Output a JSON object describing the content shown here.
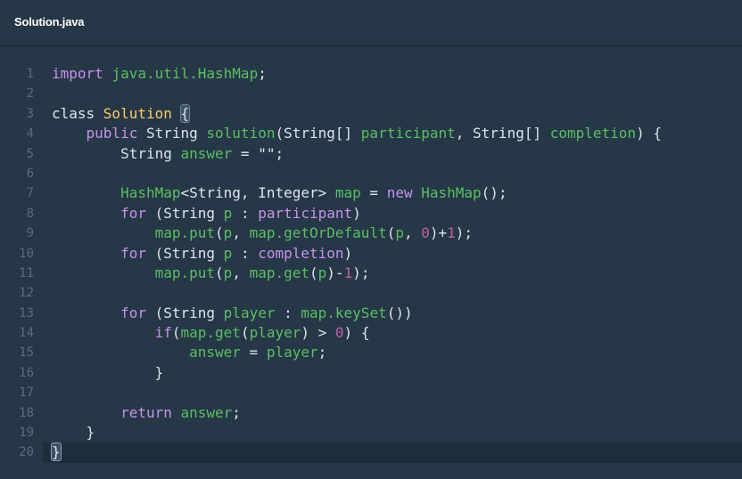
{
  "tab": {
    "filename": "Solution.java"
  },
  "editor": {
    "active_line": 20,
    "lines": [
      {
        "n": "1",
        "tokens": [
          [
            "kw",
            "import "
          ],
          [
            "id",
            "java.util.HashMap"
          ],
          [
            "pl",
            ";"
          ]
        ]
      },
      {
        "n": "2",
        "tokens": []
      },
      {
        "n": "3",
        "tokens": [
          [
            "pl",
            "class "
          ],
          [
            "cls",
            "Solution "
          ],
          [
            "brk",
            "{"
          ]
        ]
      },
      {
        "n": "4",
        "tokens": [
          [
            "pl",
            "    "
          ],
          [
            "kw",
            "public "
          ],
          [
            "pl",
            "String "
          ],
          [
            "id",
            "solution"
          ],
          [
            "pl",
            "(String[] "
          ],
          [
            "id",
            "participant"
          ],
          [
            "pl",
            ", String[] "
          ],
          [
            "id",
            "completion"
          ],
          [
            "pl",
            ") {"
          ]
        ]
      },
      {
        "n": "5",
        "tokens": [
          [
            "pl",
            "        String "
          ],
          [
            "id",
            "answer"
          ],
          [
            "pl",
            " = "
          ],
          [
            "str",
            "\"\""
          ],
          [
            "pl",
            ";"
          ]
        ]
      },
      {
        "n": "6",
        "tokens": []
      },
      {
        "n": "7",
        "tokens": [
          [
            "pl",
            "        "
          ],
          [
            "id",
            "HashMap"
          ],
          [
            "pl",
            "<String, Integer> "
          ],
          [
            "id",
            "map"
          ],
          [
            "pl",
            " = "
          ],
          [
            "kw",
            "new "
          ],
          [
            "id",
            "HashMap"
          ],
          [
            "pl",
            "();"
          ]
        ]
      },
      {
        "n": "8",
        "tokens": [
          [
            "pl",
            "        "
          ],
          [
            "kw",
            "for"
          ],
          [
            "pl",
            " (String "
          ],
          [
            "id",
            "p"
          ],
          [
            "pl",
            " : "
          ],
          [
            "kw",
            "participant"
          ],
          [
            "pl",
            ")"
          ]
        ]
      },
      {
        "n": "9",
        "tokens": [
          [
            "pl",
            "            "
          ],
          [
            "id",
            "map.put"
          ],
          [
            "pl",
            "("
          ],
          [
            "id",
            "p"
          ],
          [
            "pl",
            ", "
          ],
          [
            "id",
            "map.getOrDefault"
          ],
          [
            "pl",
            "("
          ],
          [
            "id",
            "p"
          ],
          [
            "pl",
            ", "
          ],
          [
            "num",
            "0"
          ],
          [
            "pl",
            ")+"
          ],
          [
            "num",
            "1"
          ],
          [
            "pl",
            ");"
          ]
        ]
      },
      {
        "n": "10",
        "tokens": [
          [
            "pl",
            "        "
          ],
          [
            "kw",
            "for"
          ],
          [
            "pl",
            " (String "
          ],
          [
            "id",
            "p"
          ],
          [
            "pl",
            " : "
          ],
          [
            "kw",
            "completion"
          ],
          [
            "pl",
            ")"
          ]
        ]
      },
      {
        "n": "11",
        "tokens": [
          [
            "pl",
            "            "
          ],
          [
            "id",
            "map.put"
          ],
          [
            "pl",
            "("
          ],
          [
            "id",
            "p"
          ],
          [
            "pl",
            ", "
          ],
          [
            "id",
            "map.get"
          ],
          [
            "pl",
            "("
          ],
          [
            "id",
            "p"
          ],
          [
            "pl",
            ")-"
          ],
          [
            "num",
            "1"
          ],
          [
            "pl",
            ");"
          ]
        ]
      },
      {
        "n": "12",
        "tokens": []
      },
      {
        "n": "13",
        "tokens": [
          [
            "pl",
            "        "
          ],
          [
            "kw",
            "for"
          ],
          [
            "pl",
            " (String "
          ],
          [
            "id",
            "player"
          ],
          [
            "pl",
            " : "
          ],
          [
            "id",
            "map.keySet"
          ],
          [
            "pl",
            "())"
          ]
        ]
      },
      {
        "n": "14",
        "tokens": [
          [
            "pl",
            "            "
          ],
          [
            "kw",
            "if"
          ],
          [
            "pl",
            "("
          ],
          [
            "id",
            "map.get"
          ],
          [
            "pl",
            "("
          ],
          [
            "id",
            "player"
          ],
          [
            "pl",
            ") > "
          ],
          [
            "num",
            "0"
          ],
          [
            "pl",
            ") {"
          ]
        ]
      },
      {
        "n": "15",
        "tokens": [
          [
            "pl",
            "                "
          ],
          [
            "id",
            "answer"
          ],
          [
            "pl",
            " = "
          ],
          [
            "id",
            "player"
          ],
          [
            "pl",
            ";"
          ]
        ]
      },
      {
        "n": "16",
        "tokens": [
          [
            "pl",
            "            }"
          ]
        ]
      },
      {
        "n": "17",
        "tokens": []
      },
      {
        "n": "18",
        "tokens": [
          [
            "pl",
            "        "
          ],
          [
            "kw",
            "return "
          ],
          [
            "id",
            "answer"
          ],
          [
            "pl",
            ";"
          ]
        ]
      },
      {
        "n": "19",
        "tokens": [
          [
            "pl",
            "    }"
          ]
        ]
      },
      {
        "n": "20",
        "tokens": [
          [
            "brkA",
            "}"
          ]
        ]
      }
    ]
  }
}
